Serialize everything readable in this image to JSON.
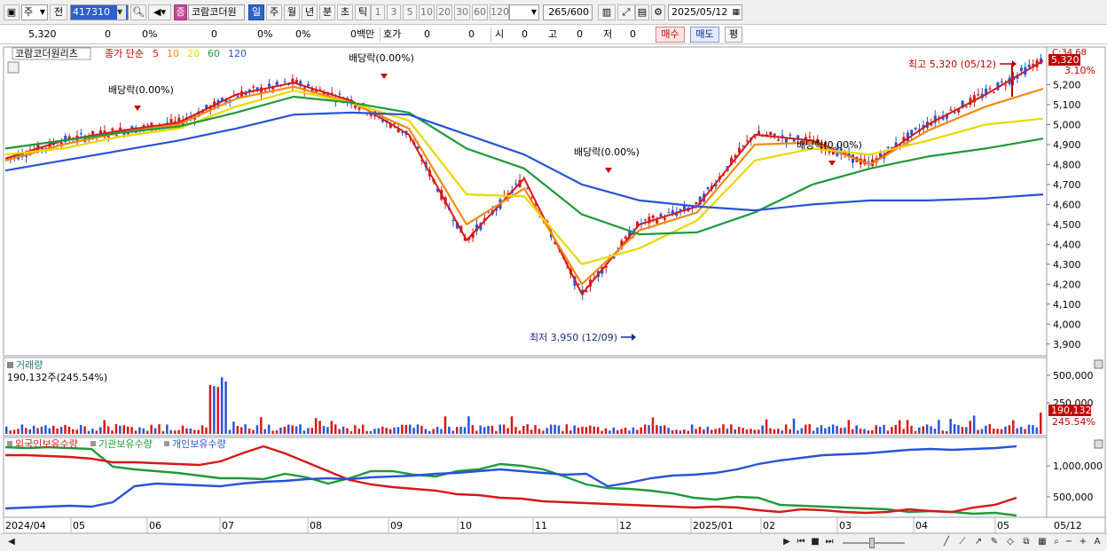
{
  "toolbar": {
    "market_select": "주",
    "period_prev": "전",
    "code": "417310",
    "stock_name": "코람코더원",
    "badge": "증",
    "periods": [
      "일",
      "주",
      "월",
      "년",
      "분",
      "초",
      "틱"
    ],
    "active_period": "일",
    "intervals": [
      "1",
      "3",
      "5",
      "10",
      "20",
      "30",
      "60",
      "120"
    ],
    "count": "265",
    "count_total": "/600",
    "date": "2025/05/12"
  },
  "quote": {
    "price": "5,320",
    "change": "0",
    "change_pct": "0%",
    "volume": "0",
    "vol_pct1": "0%",
    "vol_pct2": "0%",
    "amount": "0백만",
    "hoga_label": "호가",
    "hoga1": "0",
    "hoga2": "0",
    "open_label": "시",
    "open": "0",
    "high_label": "고",
    "high": "0",
    "low_label": "저",
    "low": "0",
    "buy_label": "매수",
    "sell_label": "매도",
    "avg_label": "평"
  },
  "price_panel": {
    "title": "코람코더원리츠",
    "ma_label": "종가 단순",
    "ma_periods": [
      {
        "label": "5",
        "color": "#d81818"
      },
      {
        "label": "10",
        "color": "#f08a10"
      },
      {
        "label": "20",
        "color": "#e8d800"
      },
      {
        "label": "60",
        "color": "#1f9a3a"
      },
      {
        "label": "120",
        "color": "#2a52d8"
      }
    ],
    "corner_value": "C:34.68",
    "last_price_label": "5,320",
    "last_pct_label": "3.10%",
    "high_annotation": "최고 5,320 (05/12)",
    "low_annotation": "최저 3,950 (12/09)",
    "dividend_labels": [
      "배당락(0.00%)",
      "배당락(0.00%)",
      "배당락(0.00%)",
      "배당락(0.00%)"
    ],
    "y_ticks": [
      "5,200",
      "5,100",
      "5,000",
      "4,900",
      "4,800",
      "4,700",
      "4,600",
      "4,500",
      "4,400",
      "4,300",
      "4,200",
      "4,100",
      "4,000",
      "3,900"
    ]
  },
  "volume_panel": {
    "title": "거래량",
    "value_label": "190,132주(245.54%)",
    "y_ticks": [
      "500,000",
      "250,000"
    ],
    "last_value": "190,132",
    "last_pct": "245.54%"
  },
  "holdings_panel": {
    "legend": [
      {
        "label": "외국인보유수량",
        "color": "#d81818"
      },
      {
        "label": "기관보유수량",
        "color": "#1f9a3a"
      },
      {
        "label": "개인보유수량",
        "color": "#2a52d8"
      }
    ],
    "y_ticks": [
      "1,000,000",
      "500,000"
    ]
  },
  "x_axis": {
    "labels": [
      "2024/04",
      "05",
      "06",
      "07",
      "08",
      "09",
      "10",
      "11",
      "12",
      "2025/01",
      "02",
      "03",
      "04",
      "05"
    ],
    "right_label": "05/12"
  },
  "colors": {
    "up": "#d81818",
    "down": "#2a52d8",
    "ma5": "#d81818",
    "ma10": "#f08a10",
    "ma20": "#e8d800",
    "ma60": "#1f9a3a",
    "ma120": "#2a52d8",
    "accent": "#2c65c8"
  },
  "chart_data": {
    "type": "line",
    "ylim": [
      3900,
      5320
    ],
    "x": [
      "2024/04",
      "05",
      "06",
      "07",
      "08",
      "09",
      "10",
      "11",
      "12",
      "2025/01",
      "02",
      "03",
      "04",
      "05"
    ],
    "series": [
      {
        "name": "5",
        "values": [
          4830,
          4920,
          4970,
          5010,
          5150,
          5210,
          5120,
          4950,
          4420,
          4730,
          4150,
          4500,
          4590,
          4950,
          4920,
          4800,
          5000,
          5150,
          5320
        ]
      },
      {
        "name": "10",
        "values": [
          4820,
          4900,
          4960,
          5000,
          5130,
          5190,
          5110,
          4980,
          4500,
          4680,
          4200,
          4470,
          4560,
          4900,
          4910,
          4800,
          4970,
          5090,
          5180
        ]
      },
      {
        "name": "20",
        "values": [
          4850,
          4880,
          4940,
          4980,
          5090,
          5170,
          5110,
          5020,
          4650,
          4640,
          4300,
          4380,
          4520,
          4820,
          4880,
          4850,
          4920,
          5000,
          5030
        ]
      },
      {
        "name": "60",
        "values": [
          4880,
          4920,
          4960,
          4990,
          5060,
          5140,
          5110,
          5060,
          4880,
          4780,
          4550,
          4450,
          4460,
          4560,
          4700,
          4780,
          4840,
          4880,
          4930
        ]
      },
      {
        "name": "120",
        "values": [
          4770,
          4820,
          4870,
          4920,
          4980,
          5050,
          5060,
          5050,
          4950,
          4850,
          4700,
          4620,
          4590,
          4570,
          4600,
          4620,
          4620,
          4630,
          4650
        ]
      }
    ]
  }
}
